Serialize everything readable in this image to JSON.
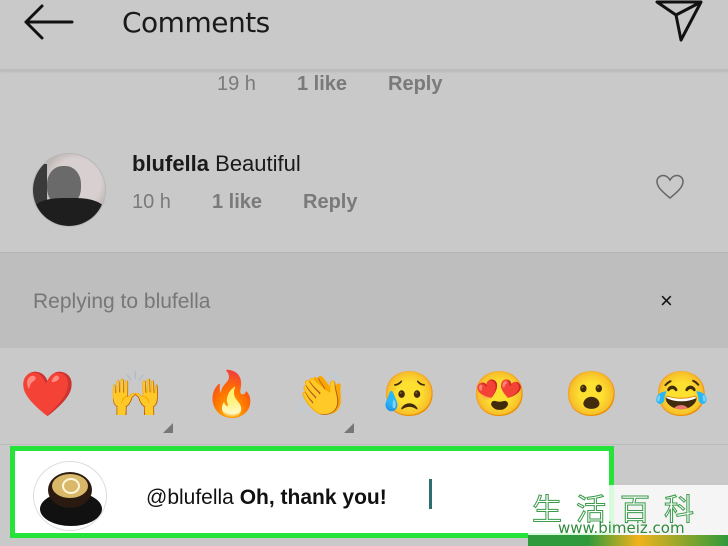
{
  "header": {
    "title": "Comments",
    "back_icon": "arrow-left-icon",
    "send_icon": "paper-plane-icon"
  },
  "previous_comment": {
    "time": "19 h",
    "likes": "1 like",
    "reply": "Reply"
  },
  "comment": {
    "username": "blufella",
    "text": "Beautiful",
    "time": "10 h",
    "likes": "1 like",
    "reply": "Reply",
    "like_icon": "heart-outline-icon"
  },
  "reply_banner": {
    "text": "Replying to blufella",
    "close_label": "×"
  },
  "emoji_bar": {
    "items": [
      {
        "name": "red-heart",
        "glyph": "❤️"
      },
      {
        "name": "raising-hands",
        "glyph": "🙌",
        "has_variants": true
      },
      {
        "name": "fire",
        "glyph": "🔥"
      },
      {
        "name": "clapping-hands",
        "glyph": "👏",
        "has_variants": true
      },
      {
        "name": "sad-tear-face",
        "glyph": "😥"
      },
      {
        "name": "heart-eyes-face",
        "glyph": "😍"
      },
      {
        "name": "surprised-face",
        "glyph": "😮"
      },
      {
        "name": "tears-of-joy-face",
        "glyph": "😂"
      }
    ]
  },
  "input": {
    "mention": "@blufella",
    "text": "Oh, thank you!",
    "highlight_color": "#26e33a"
  },
  "watermark": {
    "chinese": "生活百科",
    "url": "www.bimeiz.com"
  }
}
